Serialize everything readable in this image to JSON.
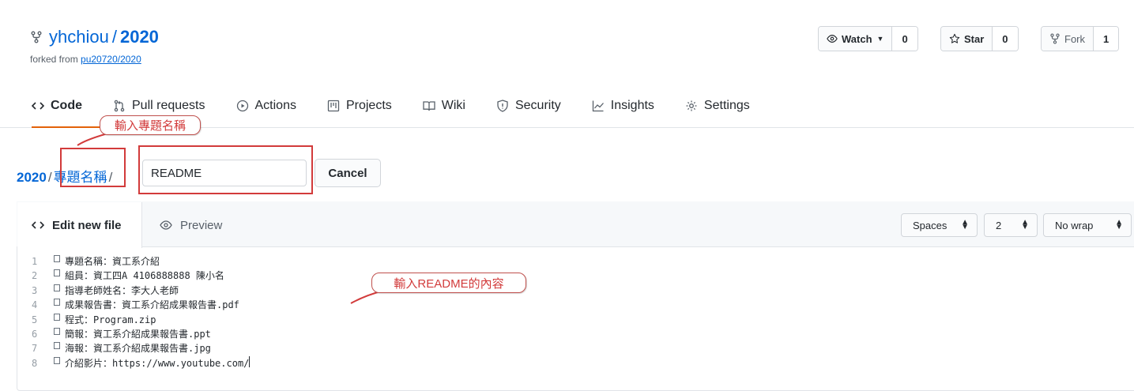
{
  "repo": {
    "owner": "yhchiou",
    "separator": "/",
    "name": "2020",
    "forked_prefix": "forked from ",
    "forked_source": "pu20720/2020"
  },
  "actions": {
    "watch_label": "Watch",
    "watch_count": "0",
    "star_label": "Star",
    "star_count": "0",
    "fork_label": "Fork",
    "fork_count": "1"
  },
  "tabs": [
    {
      "label": "Code"
    },
    {
      "label": "Pull requests"
    },
    {
      "label": "Actions"
    },
    {
      "label": "Projects"
    },
    {
      "label": "Wiki"
    },
    {
      "label": "Security"
    },
    {
      "label": "Insights"
    },
    {
      "label": "Settings"
    }
  ],
  "breadcrumb": {
    "root": "2020",
    "slash": "/",
    "folder": "專題名稱",
    "slash2": "/"
  },
  "filename": {
    "value": "README"
  },
  "cancel_label": "Cancel",
  "editor": {
    "tab_edit": "Edit new file",
    "tab_preview": "Preview",
    "indent_mode": "Spaces",
    "indent_size": "2",
    "wrap_mode": "No wrap",
    "lines": [
      {
        "n": "1",
        "text": "專題名稱：資工系介紹"
      },
      {
        "n": "2",
        "text": "組員：資工四A 4106888888 陳小名"
      },
      {
        "n": "3",
        "text": "指導老師姓名：李大人老師"
      },
      {
        "n": "4",
        "text": "成果報告書：資工系介紹成果報告書.pdf"
      },
      {
        "n": "5",
        "text": "程式：Program.zip"
      },
      {
        "n": "6",
        "text": "簡報：資工系介紹成果報告書.ppt"
      },
      {
        "n": "7",
        "text": "海報：資工系介紹成果報告書.jpg"
      },
      {
        "n": "8",
        "text": "介紹影片：https://www.youtube.com/"
      }
    ]
  },
  "annotations": {
    "project_name_callout": "輸入專題名稱",
    "readme_callout": "輸入README的內容",
    "color": "#d23b3b"
  }
}
